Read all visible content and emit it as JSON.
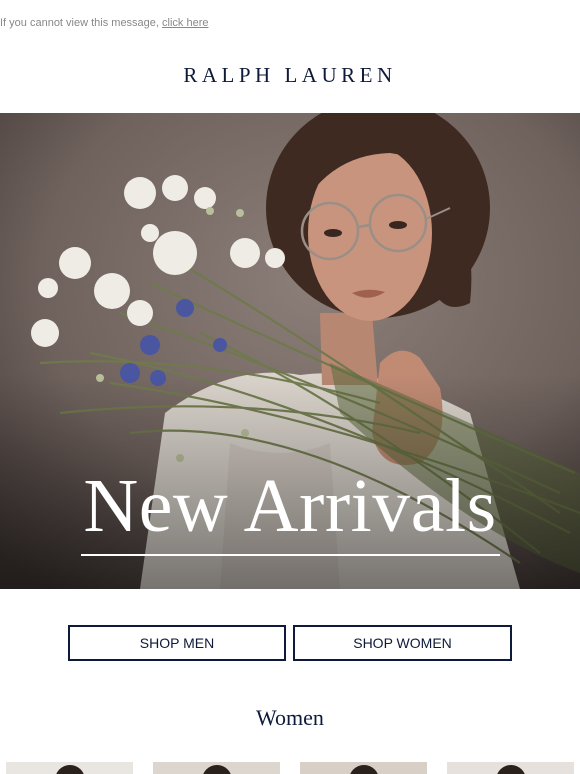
{
  "preheader": {
    "text": "If you cannot view this message, ",
    "link": "click here"
  },
  "brand": {
    "logo": "RALPH LAUREN"
  },
  "hero": {
    "title": "New Arrivals",
    "image": "woman-holding-wildflower-bouquet"
  },
  "buttons": {
    "shop_men": "SHOP MEN",
    "shop_women": "SHOP WOMEN"
  },
  "sections": {
    "women_title": "Women"
  },
  "colors": {
    "brand_navy": "#0e1a3a",
    "preheader_gray": "#888888",
    "hero_backdrop": "#6f625d"
  }
}
